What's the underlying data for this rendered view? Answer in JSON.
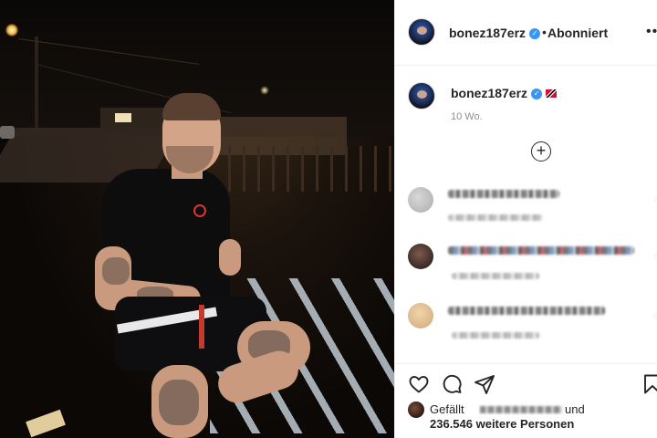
{
  "post": {
    "username": "bonez187erz",
    "follow_status": "Abonniert",
    "header_separator": "•",
    "more_icon": "•••",
    "caption_username": "bonez187erz",
    "time_ago": "10 Wo.",
    "load_more_symbol": "+"
  },
  "likes": {
    "prefix": "Gefällt",
    "suffix": "und",
    "count_text": "236.546 weitere Personen"
  },
  "icons": {
    "heart": "heart-icon",
    "comment": "comment-icon",
    "share": "paper-plane-icon",
    "save": "bookmark-icon",
    "verified": "check"
  },
  "colors": {
    "verified": "#3897f0",
    "text": "#262626",
    "muted": "#8e8e8e"
  }
}
